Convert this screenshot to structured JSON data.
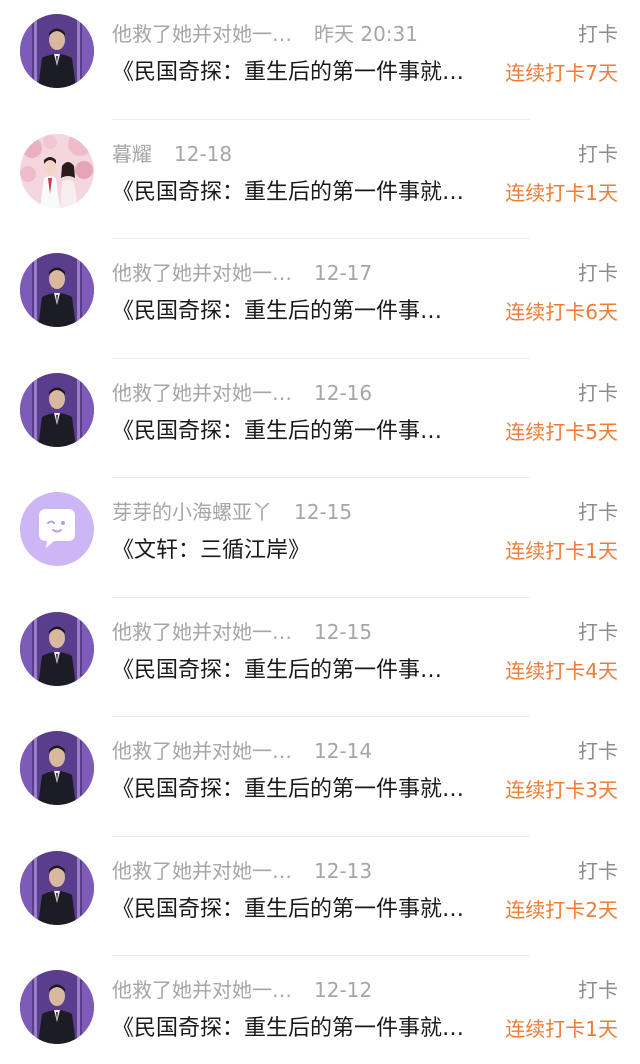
{
  "checkins": [
    {
      "avatar": "man-in-suit",
      "user": "他救了她并对她一…",
      "time": "昨天 20:31",
      "type": "打卡",
      "title": "《民国奇探：重生后的第一件事就…",
      "streak": "连续打卡7天"
    },
    {
      "avatar": "pink-blossom-couple",
      "user": "暮耀",
      "time": "12-18",
      "type": "打卡",
      "title": "《民国奇探：重生后的第一件事就…",
      "streak": "连续打卡1天"
    },
    {
      "avatar": "man-in-suit",
      "user": "他救了她并对她一…",
      "time": "12-17",
      "type": "打卡",
      "title": "《民国奇探：重生后的第一件事…",
      "streak": "连续打卡6天"
    },
    {
      "avatar": "man-in-suit",
      "user": "他救了她并对她一…",
      "time": "12-16",
      "type": "打卡",
      "title": "《民国奇探：重生后的第一件事…",
      "streak": "连续打卡5天"
    },
    {
      "avatar": "purple-chat-bubble",
      "user": "芽芽的小海螺亚丫",
      "time": "12-15",
      "type": "打卡",
      "title": "《文轩：三循江岸》",
      "streak": "连续打卡1天"
    },
    {
      "avatar": "man-in-suit",
      "user": "他救了她并对她一…",
      "time": "12-15",
      "type": "打卡",
      "title": "《民国奇探：重生后的第一件事…",
      "streak": "连续打卡4天"
    },
    {
      "avatar": "man-in-suit",
      "user": "他救了她并对她一…",
      "time": "12-14",
      "type": "打卡",
      "title": "《民国奇探：重生后的第一件事就…",
      "streak": "连续打卡3天"
    },
    {
      "avatar": "man-in-suit",
      "user": "他救了她并对她一…",
      "time": "12-13",
      "type": "打卡",
      "title": "《民国奇探：重生后的第一件事就…",
      "streak": "连续打卡2天"
    },
    {
      "avatar": "man-in-suit",
      "user": "他救了她并对她一…",
      "time": "12-12",
      "type": "打卡",
      "title": "《民国奇探：重生后的第一件事就…",
      "streak": "连续打卡1天"
    }
  ],
  "colors": {
    "streak": "#ef7b34",
    "meta": "#a6a6a6",
    "title": "#1a1a1a",
    "avatar_purple": "#cdb6f5"
  }
}
